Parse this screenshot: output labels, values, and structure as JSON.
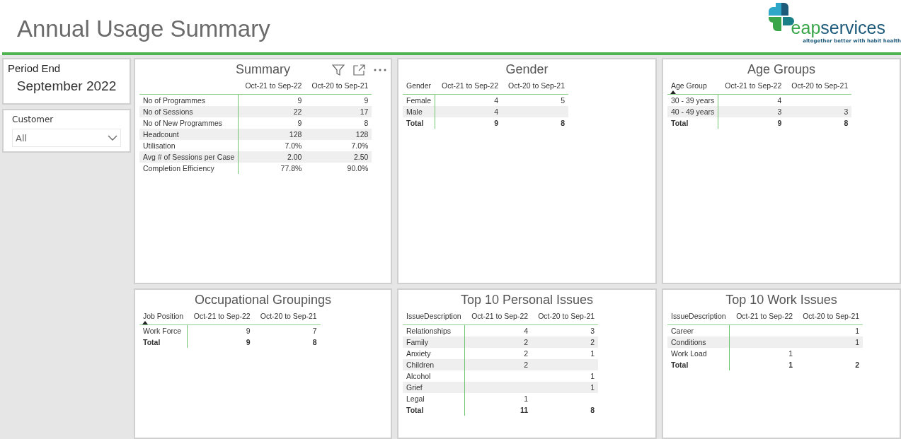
{
  "title": "Annual Usage Summary",
  "logo": {
    "name_part_1": "eap",
    "name_part_2": "services",
    "tagline": "altogether better with habit health"
  },
  "period_card": {
    "label": "Period End",
    "value": "September 2022"
  },
  "customer_slicer": {
    "label": "Customer",
    "value": "All"
  },
  "visuals": [
    {
      "title": "Summary",
      "toolbar": true,
      "columns": [
        "Oct-21 to Sep-22",
        "Oct-20 to Sep-21"
      ],
      "rows": [
        {
          "label": "No of Programmes",
          "period_1": "9",
          "period_2": "9"
        },
        {
          "label": "No of Sessions",
          "period_1": "22",
          "period_2": "17"
        },
        {
          "label": "No of New Programmes",
          "period_1": "9",
          "period_2": "8"
        },
        {
          "label": "Headcount",
          "period_1": "128",
          "period_2": "128"
        },
        {
          "label": "Utilisation",
          "period_1": "7.0%",
          "period_2": "7.0%"
        },
        {
          "label": "Avg # of Sessions per Case",
          "period_1": "2.00",
          "period_2": "2.50"
        },
        {
          "label": "Completion Efficiency",
          "period_1": "77.8%",
          "period_2": "90.0%"
        }
      ]
    },
    {
      "title": "Gender",
      "row_header": {
        "label": "Gender"
      },
      "columns": [
        "Oct-21 to Sep-22",
        "Oct-20 to Sep-21"
      ],
      "rows": [
        {
          "label": "Female",
          "period_1": "4",
          "period_2": "5"
        },
        {
          "label": "Male",
          "period_1": "4"
        }
      ],
      "total": {
        "label": "Total",
        "period_1": "9",
        "period_2": "8"
      }
    },
    {
      "title": "Age Groups",
      "row_header": {
        "label": "Age Group",
        "sorted": true
      },
      "columns": [
        "Oct-21 to Sep-22",
        "Oct-20 to Sep-21"
      ],
      "rows": [
        {
          "label": "30 - 39 years",
          "period_1": "4"
        },
        {
          "label": "40 - 49 years",
          "period_1": "3",
          "period_2": "3"
        }
      ],
      "total": {
        "label": "Total",
        "period_1": "9",
        "period_2": "8"
      }
    },
    {
      "title": "Occupational Groupings",
      "row_header": {
        "label": "Job Position",
        "sorted": true
      },
      "columns": [
        "Oct-21 to Sep-22",
        "Oct-20 to Sep-21"
      ],
      "rows": [
        {
          "label": "Work Force",
          "period_1": "9",
          "period_2": "7"
        }
      ],
      "total": {
        "label": "Total",
        "period_1": "9",
        "period_2": "8"
      }
    },
    {
      "title": "Top 10 Personal Issues",
      "row_header": {
        "label": "IssueDescription"
      },
      "columns": [
        "Oct-21 to Sep-22",
        "Oct-20 to Sep-21"
      ],
      "rows": [
        {
          "label": "Relationships",
          "period_1": "4",
          "period_2": "3"
        },
        {
          "label": "Family",
          "period_1": "2",
          "period_2": "2"
        },
        {
          "label": "Anxiety",
          "period_1": "2",
          "period_2": "1"
        },
        {
          "label": "Children",
          "period_1": "2"
        },
        {
          "label": "Alcohol",
          "period_2": "1"
        },
        {
          "label": "Grief",
          "period_2": "1"
        },
        {
          "label": "Legal",
          "period_1": "1"
        }
      ],
      "total": {
        "label": "Total",
        "period_1": "11",
        "period_2": "8"
      }
    },
    {
      "title": "Top 10 Work Issues",
      "row_header": {
        "label": "IssueDescription"
      },
      "columns": [
        "Oct-21 to Sep-22",
        "Oct-20 to Sep-21"
      ],
      "rows": [
        {
          "label": "Career",
          "period_2": "1"
        },
        {
          "label": "Conditions",
          "period_2": "1"
        },
        {
          "label": "Work Load",
          "period_1": "1"
        }
      ],
      "total": {
        "label": "Total",
        "period_1": "1",
        "period_2": "2"
      }
    }
  ]
}
